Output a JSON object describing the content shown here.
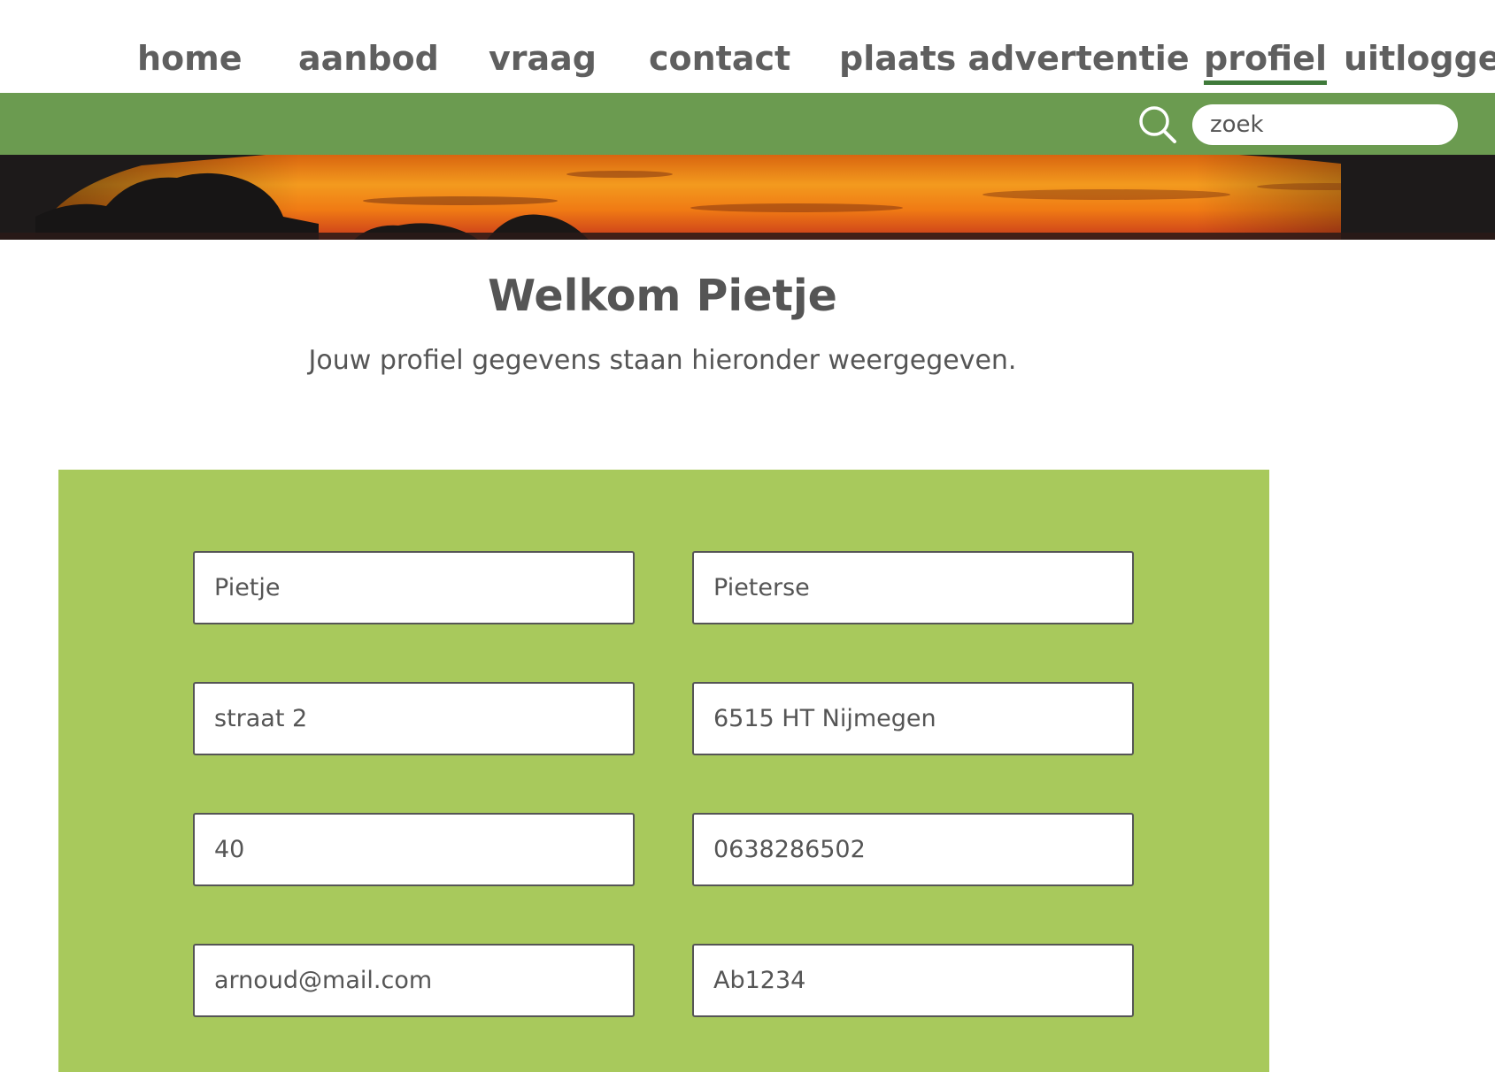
{
  "colors": {
    "nav_text": "#5f5f5f",
    "active_underline": "#3f7a3a",
    "search_bar": "#6b9b50",
    "form_panel": "#a8c95c",
    "text": "#555555"
  },
  "nav": {
    "items": [
      {
        "label": "home",
        "active": false
      },
      {
        "label": "aanbod",
        "active": false
      },
      {
        "label": "vraag",
        "active": false
      },
      {
        "label": "contact",
        "active": false
      },
      {
        "label": "plaats advertentie",
        "active": false
      },
      {
        "label": "profiel",
        "active": true
      },
      {
        "label": "uitloggen",
        "active": false
      }
    ]
  },
  "search": {
    "icon": "search-icon",
    "placeholder": "zoek",
    "value": ""
  },
  "hero": {
    "description": "sunset banner"
  },
  "main": {
    "title": "Welkom Pietje",
    "subtitle": "Jouw profiel gegevens staan hieronder weergegeven."
  },
  "form": {
    "fields": [
      {
        "value": "Pietje"
      },
      {
        "value": "Pieterse"
      },
      {
        "value": "straat 2"
      },
      {
        "value": "6515 HT Nijmegen"
      },
      {
        "value": "40"
      },
      {
        "value": "0638286502"
      },
      {
        "value": "arnoud@mail.com"
      },
      {
        "value": "Ab1234"
      }
    ]
  }
}
